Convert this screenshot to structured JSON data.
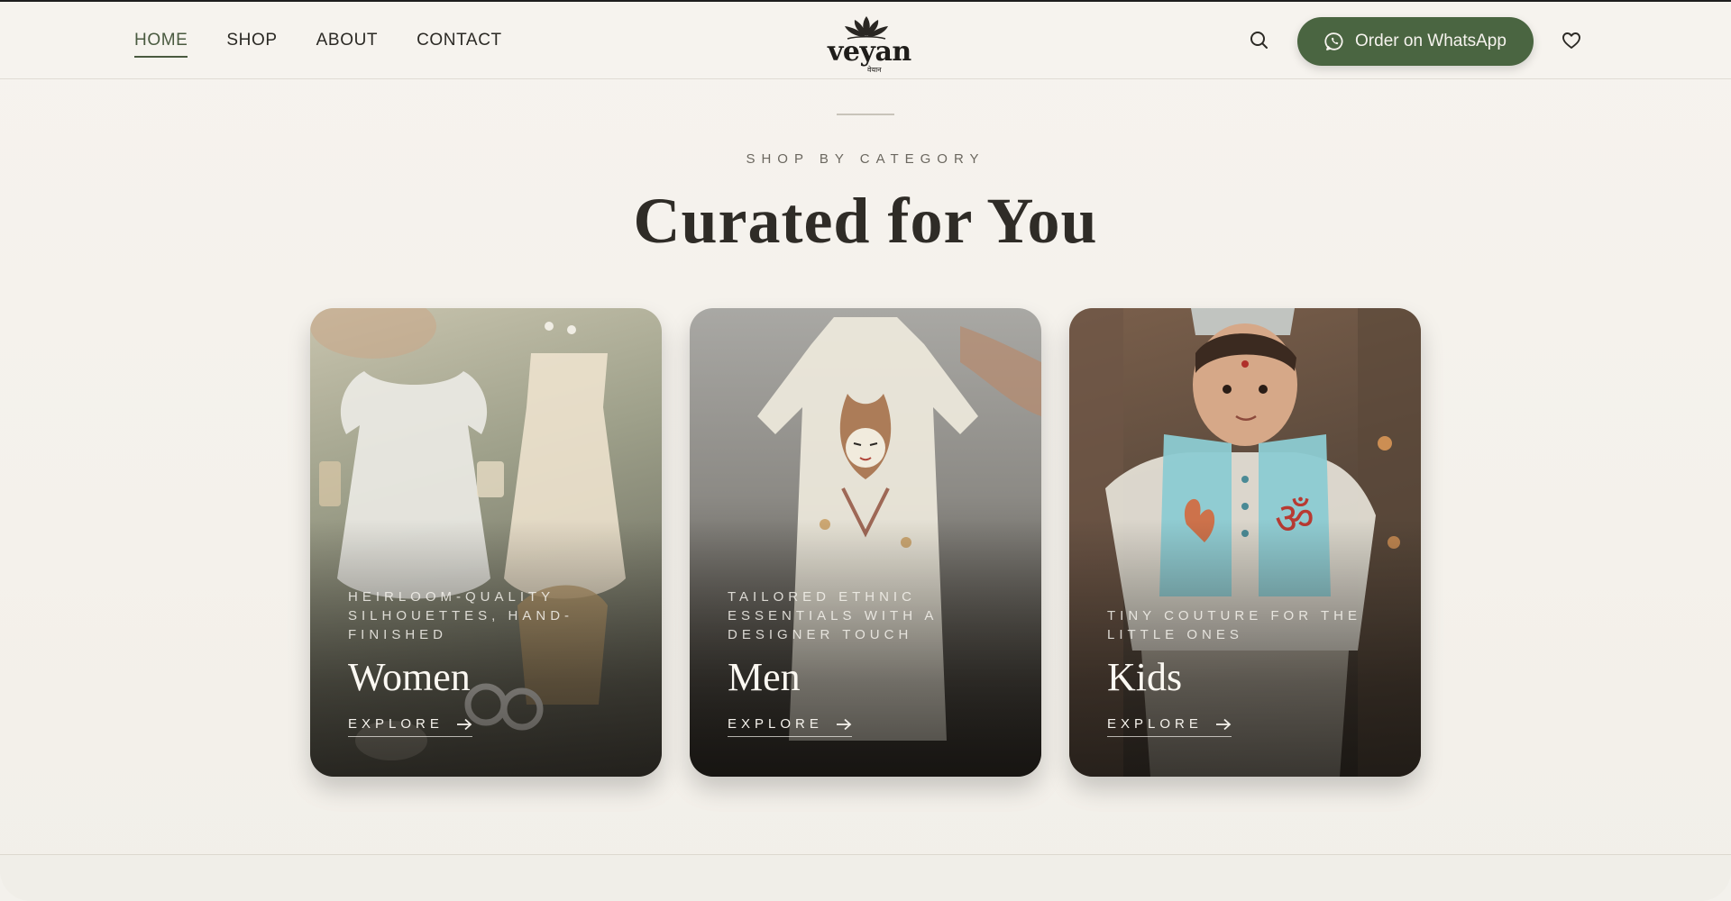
{
  "nav": {
    "items": [
      {
        "label": "HOME",
        "active": true
      },
      {
        "label": "SHOP"
      },
      {
        "label": "ABOUT"
      },
      {
        "label": "CONTACT"
      }
    ]
  },
  "brand": {
    "name": "veyan",
    "sub": "वेयान"
  },
  "header": {
    "whatsapp_label": "Order on WhatsApp"
  },
  "section": {
    "eyebrow": "SHOP BY CATEGORY",
    "title": "Curated for You"
  },
  "categories": [
    {
      "tagline": "Heirloom-quality silhouettes, hand-finished",
      "name": "Women",
      "cta": "EXPLORE"
    },
    {
      "tagline": "Tailored ethnic essentials with a designer touch",
      "name": "Men",
      "cta": "EXPLORE"
    },
    {
      "tagline": "Tiny couture for the little ones",
      "name": "Kids",
      "cta": "EXPLORE"
    }
  ],
  "colors": {
    "accent": "#4a6541",
    "background": "#f4f1eb",
    "text": "#2b2924"
  },
  "icons": [
    "search-icon",
    "whatsapp-icon",
    "heart-icon",
    "lotus-logo-icon",
    "arrow-right-icon"
  ]
}
